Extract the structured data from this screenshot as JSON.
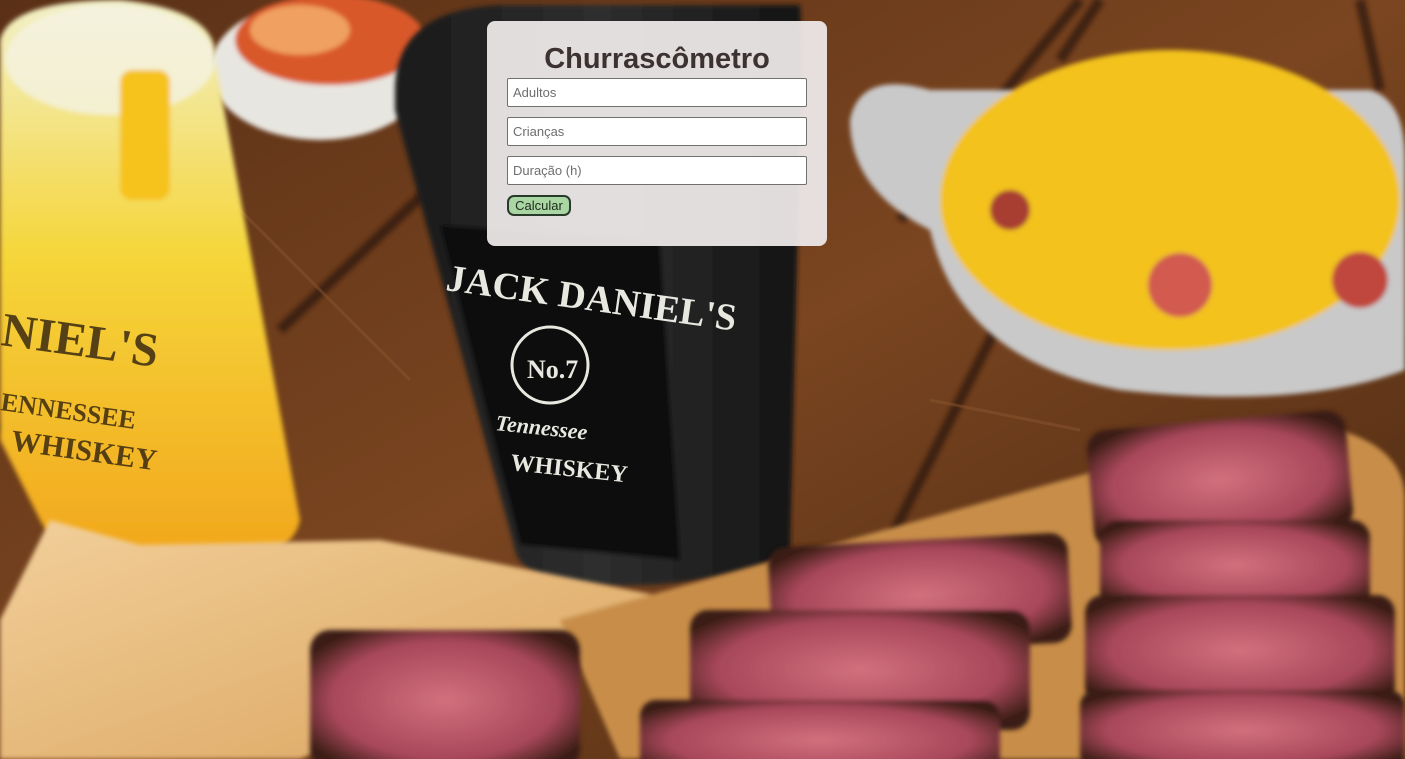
{
  "app": {
    "title": "Churrascômetro"
  },
  "form": {
    "adults_placeholder": "Adultos",
    "children_placeholder": "Crianças",
    "duration_placeholder": "Duração (h)",
    "calculate_label": "Calcular"
  },
  "background": {
    "label_text_1": "NIEL'S",
    "label_text_2": "JACK DANIEL'S",
    "label_text_3": "No.7",
    "label_text_4": "Tennessee",
    "label_text_5": "WHISKEY"
  },
  "colors": {
    "panel_bg": "#f0ecec",
    "title": "#3d3232",
    "button_bg": "#a9d6a3",
    "button_border": "#2a3a2a"
  }
}
